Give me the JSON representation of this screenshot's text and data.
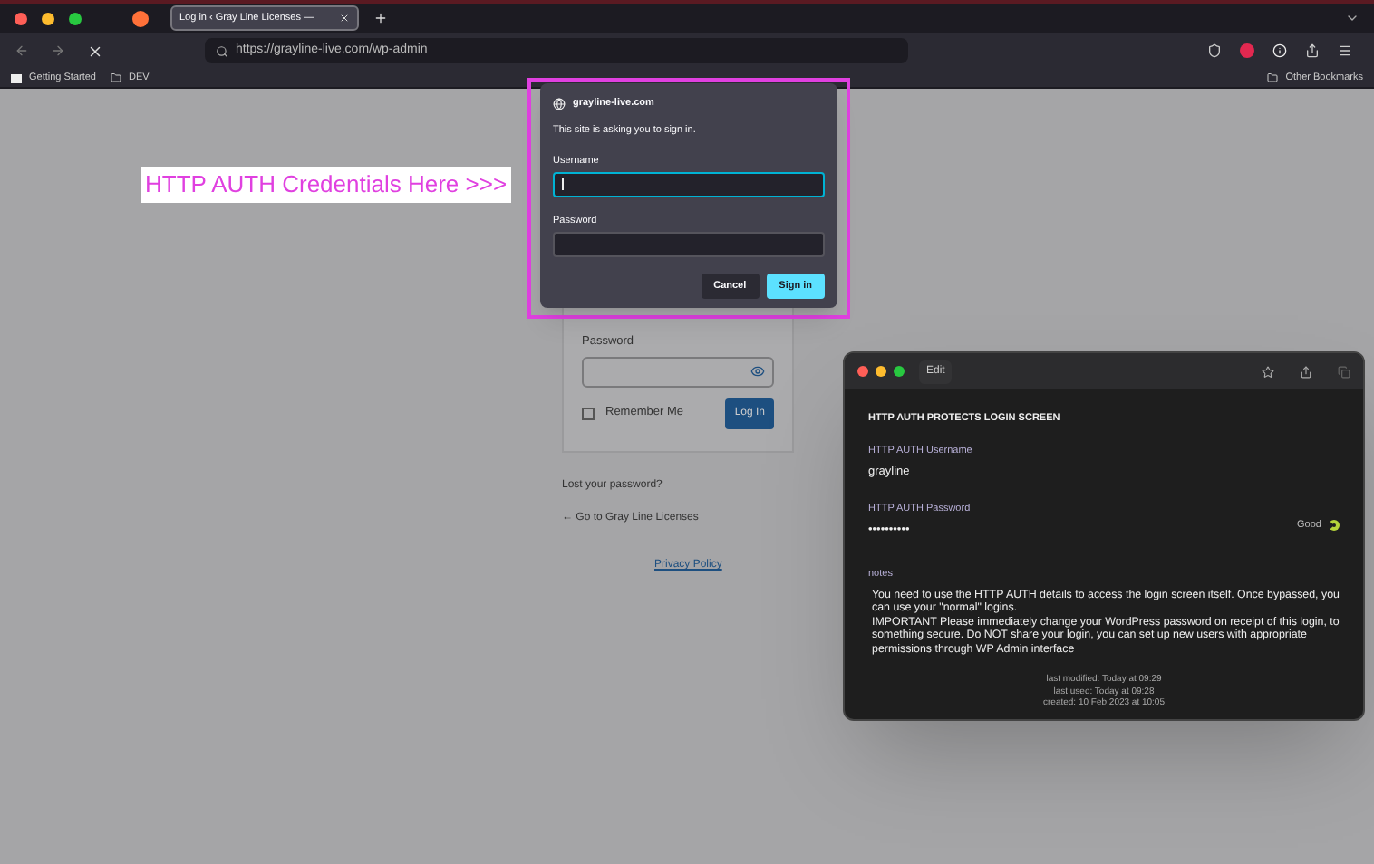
{
  "browser": {
    "tab": {
      "title": "Log in ‹ Gray Line Licenses —",
      "selected": true
    },
    "url": "https://grayline-live.com/wp-admin",
    "bookmarks": [
      "Getting Started",
      "DEV"
    ],
    "other_bookmarks": "Other Bookmarks"
  },
  "annotation": "HTTP AUTH Credentials Here >>>",
  "auth_dialog": {
    "host": "grayline-live.com",
    "message": "This site is asking you to sign in.",
    "fields": [
      {
        "label": "Username",
        "focused": true
      },
      {
        "label": "Password",
        "focused": false
      }
    ],
    "buttons": [
      {
        "label": "Cancel",
        "kind": "secondary"
      },
      {
        "label": "Sign in",
        "kind": "primary"
      }
    ]
  },
  "login_form": {
    "password_label": "Password",
    "remember": {
      "label": "Remember Me",
      "checked": false
    },
    "login_button": "Log In",
    "lost_password": "Lost your password?",
    "back_link": "← Go to Gray Line Licenses",
    "privacy": "Privacy Policy"
  },
  "notes_window": {
    "edit_button": "Edit",
    "heading": "HTTP AUTH PROTECTS LOGIN SCREEN",
    "fields": [
      {
        "label": "HTTP AUTH Username",
        "value": "grayline"
      },
      {
        "label": "HTTP AUTH Password",
        "value": "••••••••••",
        "strength": "Good"
      }
    ],
    "notes_label": "notes",
    "notes": [
      "You need to use the HTTP AUTH details to access the login screen itself. Once bypassed, you can use your \"normal\" logins.",
      "IMPORTANT Please immediately change your WordPress password on receipt of this login, to something secure. Do NOT share your login, you can set up new users with appropriate permissions through WP Admin interface"
    ],
    "meta": [
      "last modified: Today at 09:29",
      "last used: Today at 09:28",
      "created: 10 Feb 2023 at 10:05"
    ]
  }
}
